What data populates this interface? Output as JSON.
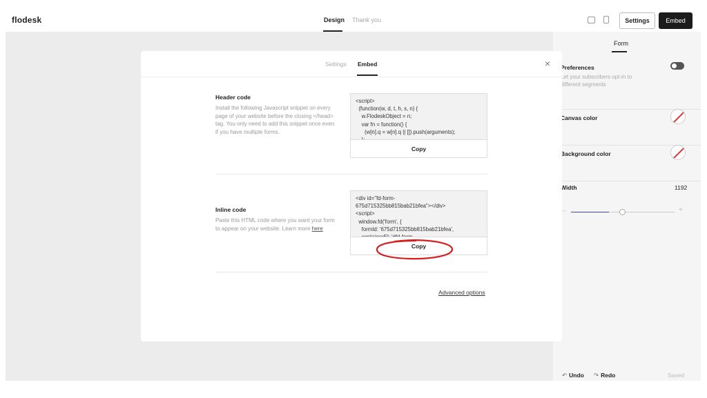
{
  "app": {
    "logo": "flodesk"
  },
  "header": {
    "tabs": [
      {
        "label": "Design",
        "active": true
      },
      {
        "label": "Thank you",
        "active": false
      }
    ],
    "settings_label": "Settings",
    "embed_label": "Embed"
  },
  "right_panel": {
    "tab": "Form",
    "preferences": {
      "label": "Preferences",
      "description": "Let your subscribers opt-in to different segments",
      "enabled": true
    },
    "canvas_color": {
      "label": "Canvas color"
    },
    "background_color": {
      "label": "Background color"
    },
    "width": {
      "label": "Width",
      "value": "1192",
      "minus": "–",
      "plus": "+"
    },
    "undo_label": "Undo",
    "redo_label": "Redo",
    "saved_label": "Saved"
  },
  "modal": {
    "tabs": [
      {
        "label": "Settings",
        "active": false
      },
      {
        "label": "Embed",
        "active": true
      }
    ],
    "close": "×",
    "header_code": {
      "title": "Header code",
      "description": "Install the following Javascript snippet on every page of your website before the closing </head> tag. You only need to add this snippet once even if you have multiple forms.",
      "code": "<script>\n  (function(w, d, t, h, s, n) {\n    w.FlodeskObject = n;\n    var fn = function() {\n      (w[n].q = w[n].q || []).push(arguments);\n    };",
      "copy_label": "Copy"
    },
    "inline_code": {
      "title": "Inline code",
      "description": "Paste this HTML code where you want your form to appear on your website. Learn more",
      "link": "here",
      "code": "<div id=\"fd-form-\n675d715325bb815bab21bfea\"></div>\n<script>\n  window.fd('form', {\n    formId: '675d715325bb815bab21bfea',\n    containerEl: '#fd-form-",
      "copy_label": "Copy"
    },
    "advanced_options": "Advanced options"
  },
  "colors": {
    "primary": "#1c1c1c",
    "annotation": "#d41f1f",
    "slider_fill": "#3a4a9a"
  }
}
